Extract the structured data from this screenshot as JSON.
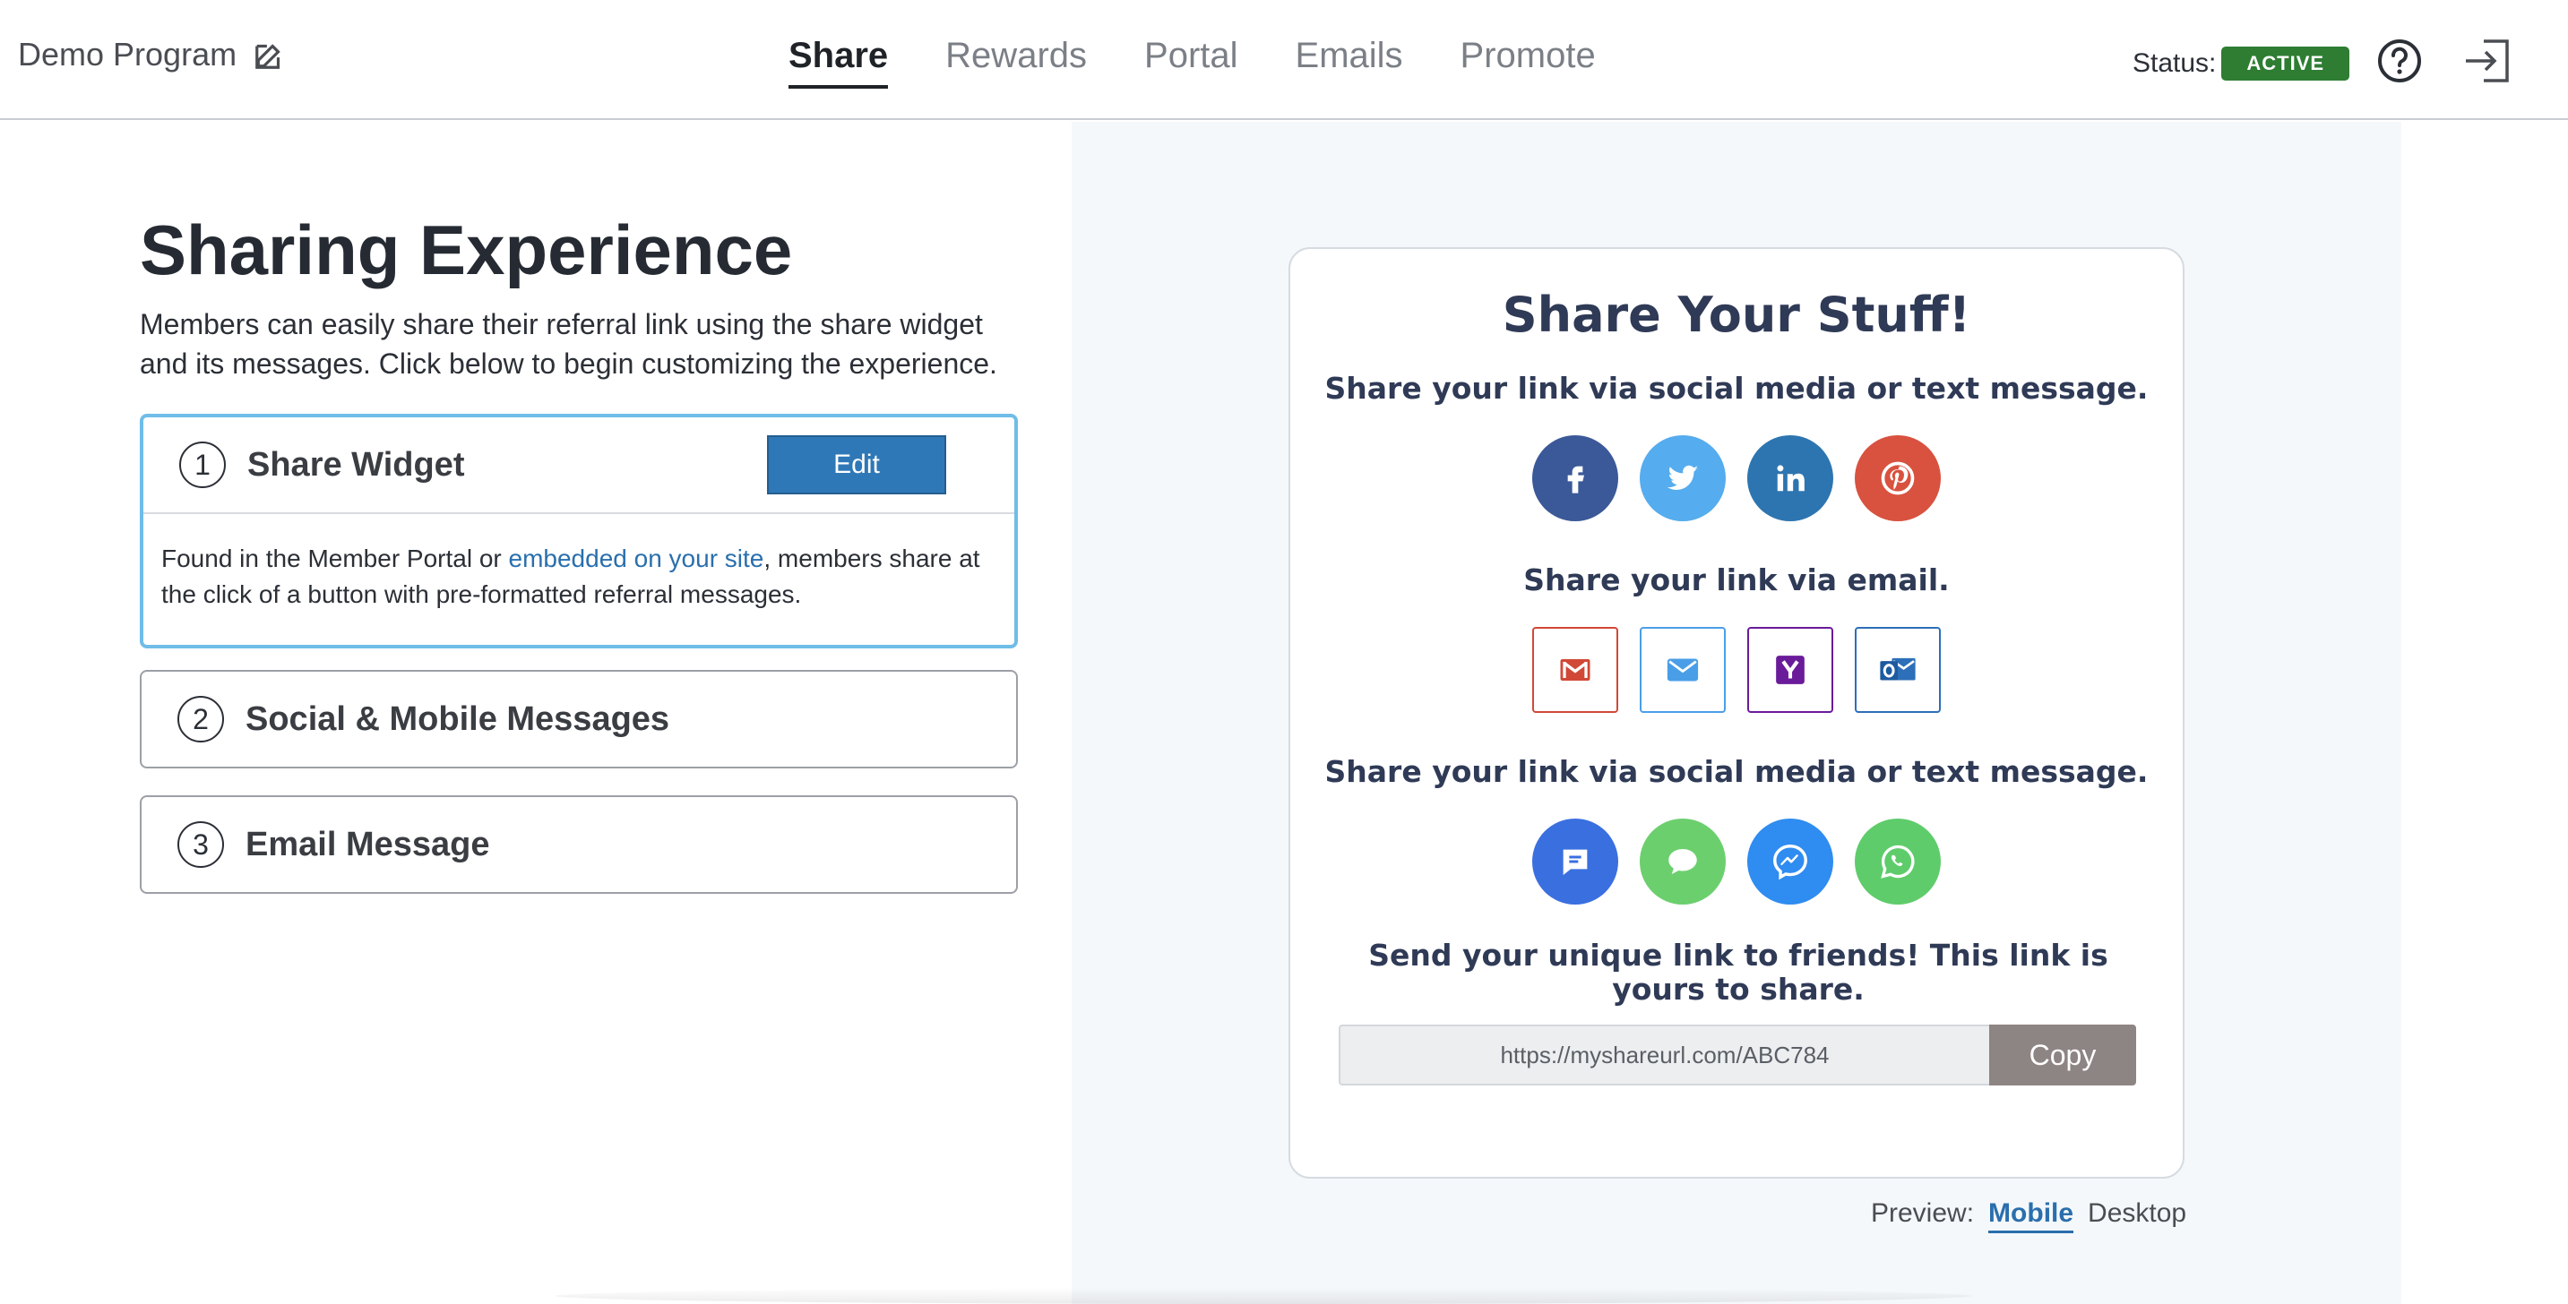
{
  "header": {
    "program_name": "Demo Program",
    "tabs": [
      {
        "label": "Share",
        "active": true
      },
      {
        "label": "Rewards",
        "active": false
      },
      {
        "label": "Portal",
        "active": false
      },
      {
        "label": "Emails",
        "active": false
      },
      {
        "label": "Promote",
        "active": false
      }
    ],
    "status_label": "Status:",
    "status_value": "ACTIVE",
    "icons": {
      "edit": "edit-icon",
      "help": "help-icon",
      "logout": "logout-icon"
    }
  },
  "left": {
    "title": "Sharing Experience",
    "description": "Members can easily share their referral link using the share widget and its messages. Click below to begin customizing the experience.",
    "cards": [
      {
        "number": "1",
        "title": "Share Widget",
        "edit_label": "Edit",
        "body_before": "Found in the Member Portal or ",
        "body_link": "embedded on your site",
        "body_after": ", members share at the click of a button with pre-formatted referral messages."
      },
      {
        "number": "2",
        "title": "Social & Mobile Messages"
      },
      {
        "number": "3",
        "title": "Email Message"
      }
    ]
  },
  "preview": {
    "title": "Share Your Stuff!",
    "social_heading": "Share your link via social media or text message.",
    "social_icons": [
      "facebook-icon",
      "twitter-icon",
      "linkedin-icon",
      "pinterest-icon"
    ],
    "email_heading": "Share your link via email.",
    "email_icons": [
      "gmail-icon",
      "mail-icon",
      "yahoo-icon",
      "outlook-icon"
    ],
    "sms_heading": "Share your link via social media or text message.",
    "sms_icons": [
      "sms-icon",
      "imessage-icon",
      "messenger-icon",
      "whatsapp-icon"
    ],
    "link_heading": "Send your unique link to friends! This link is yours to share.",
    "link_value": "https://myshareurl.com/ABC784",
    "copy_label": "Copy",
    "toggle_label": "Preview:",
    "toggle_mobile": "Mobile",
    "toggle_desktop": "Desktop"
  },
  "colors": {
    "accent": "#2f78b7",
    "status_green": "#2e7d32",
    "facebook": "#3b5998",
    "twitter": "#55acee",
    "linkedin": "#2d75b0",
    "pinterest": "#d8523f",
    "copy_button": "#8d8583"
  }
}
